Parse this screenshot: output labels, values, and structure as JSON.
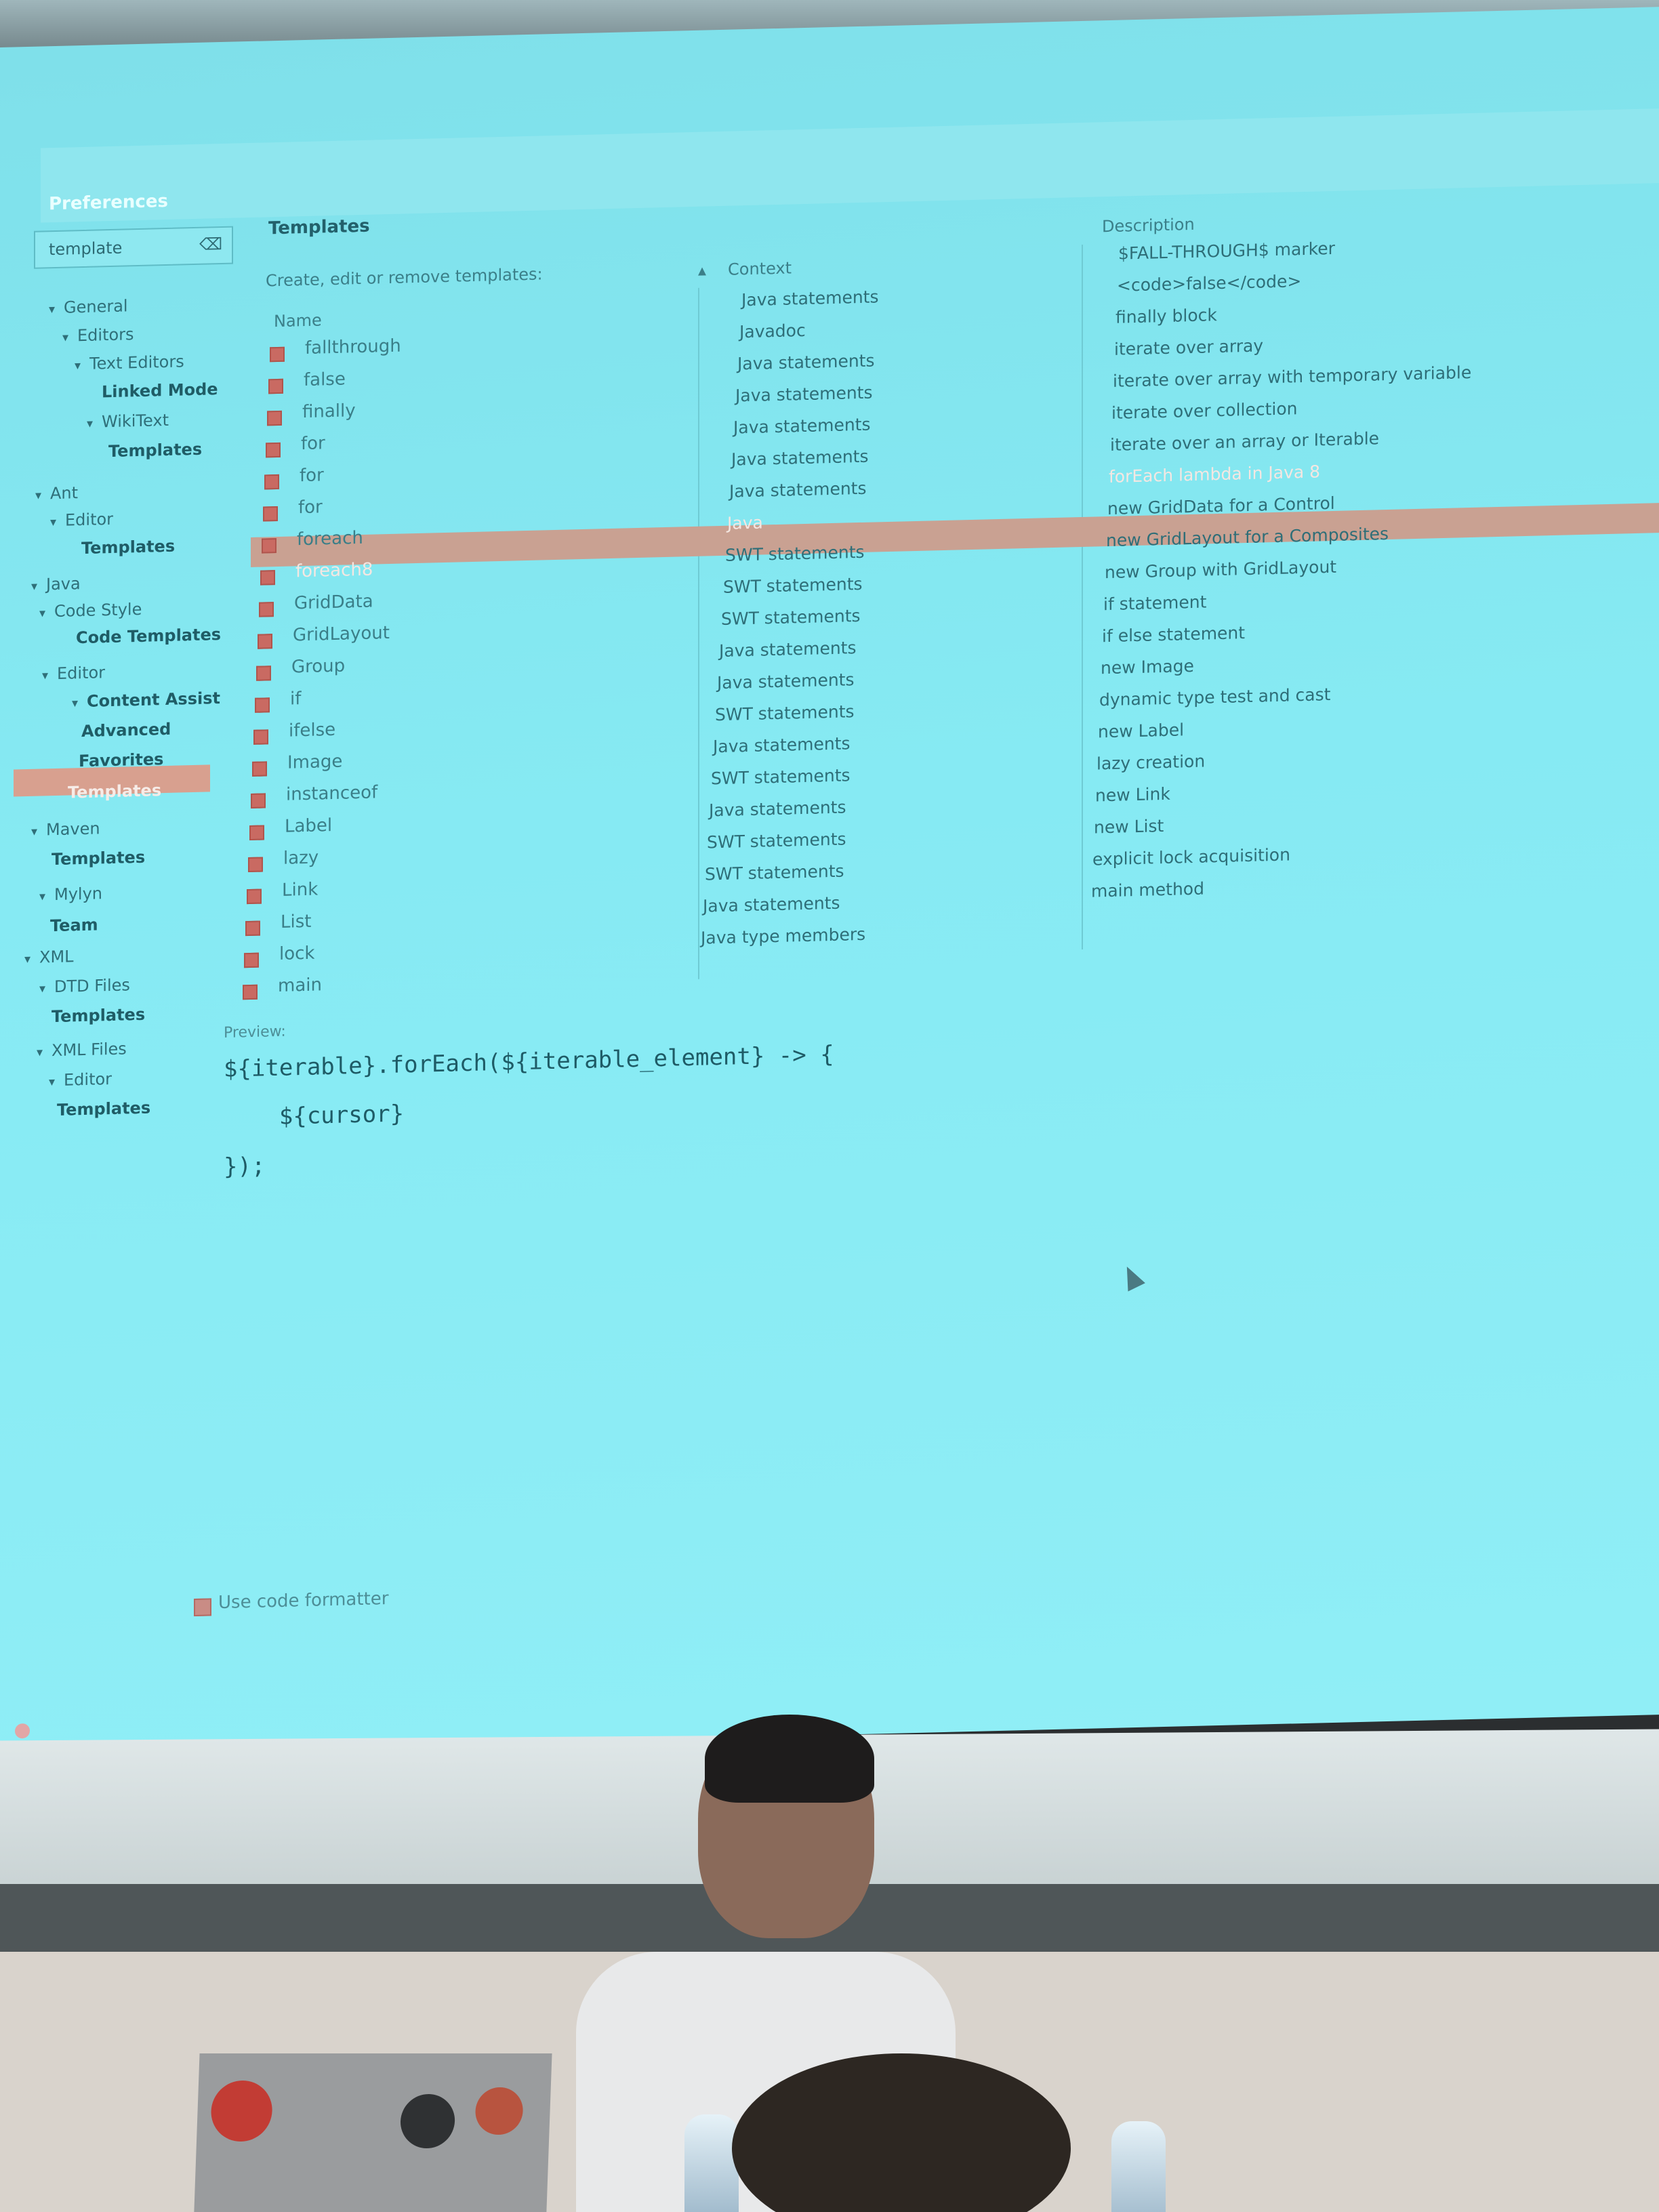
{
  "window": {
    "title": "Preferences"
  },
  "filter": {
    "value": "template",
    "clear_icon": "clear-icon"
  },
  "tree": [
    {
      "label": "General",
      "bold": false
    },
    {
      "label": "Editors",
      "bold": false
    },
    {
      "label": "Text Editors",
      "bold": false
    },
    {
      "label": "Linked Mode",
      "bold": true
    },
    {
      "label": "WikiText",
      "bold": false
    },
    {
      "label": "Templates",
      "bold": true
    },
    {
      "label": "Ant",
      "bold": false
    },
    {
      "label": "Editor",
      "bold": false
    },
    {
      "label": "Templates",
      "bold": true
    },
    {
      "label": "Java",
      "bold": false
    },
    {
      "label": "Code Style",
      "bold": false
    },
    {
      "label": "Code Templates",
      "bold": true
    },
    {
      "label": "Editor",
      "bold": false
    },
    {
      "label": "Content Assist",
      "bold": true
    },
    {
      "label": "Advanced",
      "bold": true
    },
    {
      "label": "Favorites",
      "bold": true
    },
    {
      "label": "Templates",
      "bold": true,
      "selected": true
    },
    {
      "label": "Maven",
      "bold": false
    },
    {
      "label": "Templates",
      "bold": true
    },
    {
      "label": "Mylyn",
      "bold": false
    },
    {
      "label": "Team",
      "bold": true
    },
    {
      "label": "XML",
      "bold": false
    },
    {
      "label": "DTD Files",
      "bold": false
    },
    {
      "label": "Templates",
      "bold": true
    },
    {
      "label": "XML Files",
      "bold": false
    },
    {
      "label": "Editor",
      "bold": false
    },
    {
      "label": "Templates",
      "bold": true
    }
  ],
  "section": {
    "title": "Templates",
    "description": "Create, edit or remove templates:"
  },
  "table": {
    "headers": {
      "name": "Name",
      "context": "Context",
      "description": "Description"
    },
    "rows": [
      {
        "name": "fallthrough",
        "context": "Java statements",
        "description": "$FALL-THROUGH$ marker"
      },
      {
        "name": "false",
        "context": "Javadoc",
        "description": "<code>false</code>"
      },
      {
        "name": "finally",
        "context": "Java statements",
        "description": "finally block"
      },
      {
        "name": "for",
        "context": "Java statements",
        "description": "iterate over array"
      },
      {
        "name": "for",
        "context": "Java statements",
        "description": "iterate over array with temporary variable"
      },
      {
        "name": "for",
        "context": "Java statements",
        "description": "iterate over collection"
      },
      {
        "name": "foreach",
        "context": "Java statements",
        "description": "iterate over an array or Iterable"
      },
      {
        "name": "foreach8",
        "context": "Java",
        "description": "forEach lambda in Java 8"
      },
      {
        "name": "GridData",
        "context": "SWT statements",
        "description": "new GridData for a Control"
      },
      {
        "name": "GridLayout",
        "context": "SWT statements",
        "description": "new GridLayout for a Composites"
      },
      {
        "name": "Group",
        "context": "SWT statements",
        "description": "new Group with GridLayout"
      },
      {
        "name": "if",
        "context": "Java statements",
        "description": "if statement"
      },
      {
        "name": "ifelse",
        "context": "Java statements",
        "description": "if else statement"
      },
      {
        "name": "Image",
        "context": "SWT statements",
        "description": "new Image"
      },
      {
        "name": "instanceof",
        "context": "Java statements",
        "description": "dynamic type test and cast"
      },
      {
        "name": "Label",
        "context": "SWT statements",
        "description": "new Label"
      },
      {
        "name": "lazy",
        "context": "Java statements",
        "description": "lazy creation"
      },
      {
        "name": "Link",
        "context": "SWT statements",
        "description": "new Link"
      },
      {
        "name": "List",
        "context": "SWT statements",
        "description": "new List"
      },
      {
        "name": "lock",
        "context": "Java statements",
        "description": "explicit lock acquisition"
      },
      {
        "name": "main",
        "context": "Java type members",
        "description": "main method"
      }
    ],
    "selected_index": 7
  },
  "preview": {
    "label": "Preview:",
    "code": "${iterable}.forEach(${iterable_element} -> {\n    ${cursor}\n});"
  },
  "formatter": {
    "label": "Use code formatter",
    "checked": true
  }
}
